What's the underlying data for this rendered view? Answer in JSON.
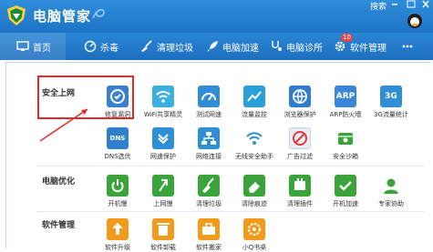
{
  "window": {
    "title": "电脑管家",
    "search_label": "搜索",
    "search_left_char": "o"
  },
  "nav": {
    "items": [
      {
        "label": "首页",
        "icon": "monitor-icon"
      },
      {
        "label": "杀毒",
        "icon": "scan-icon"
      },
      {
        "label": "清理垃圾",
        "icon": "broom-icon"
      },
      {
        "label": "电脑加速",
        "icon": "rocket-icon"
      },
      {
        "label": "电脑诊所",
        "icon": "stethoscope-icon"
      },
      {
        "label": "软件管理",
        "icon": "gear-icon",
        "badge": "10"
      }
    ]
  },
  "sections": [
    {
      "title": "安全上网"
    },
    {
      "title": "电脑优化"
    },
    {
      "title": "软件管理"
    }
  ],
  "tiles": {
    "row1": [
      "修复漏洞",
      "WiFi共享精灵",
      "测试网速",
      "流量监控",
      "浏览器保护",
      "ARP防火墙",
      "3G流量统计"
    ],
    "row2": [
      "DNS选优",
      "网速保护",
      "网络连接",
      "无线安全助手",
      "广告过滤",
      "安全沙箱"
    ],
    "row3": [
      "开机慢",
      "上网慢",
      "清理垃圾",
      "清除痕迹",
      "清理插件",
      "开机加速",
      "专家协助"
    ],
    "row4": [
      "软件升级",
      "软件卸载",
      "软件搬家",
      "小Q书桌"
    ]
  },
  "glyphs": {
    "arp": "ARP",
    "g3": "3G",
    "dns": "DNS"
  },
  "colors": {
    "titlebar": "#2f8edc",
    "accent_green": "#3aa43a",
    "accent_orange": "#f29a1b",
    "highlight_red": "#e02b2b"
  }
}
